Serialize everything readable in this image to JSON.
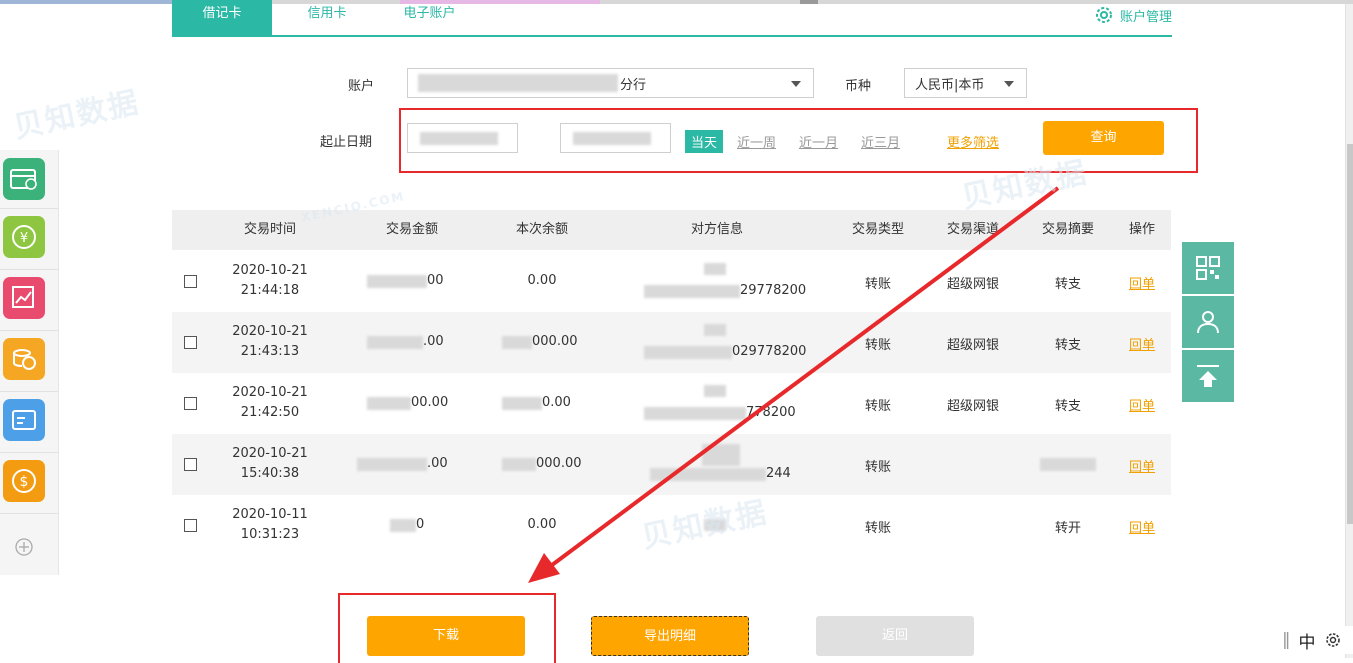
{
  "tabs": [
    {
      "label": "借记卡",
      "active": true
    },
    {
      "label": "信用卡",
      "active": false
    },
    {
      "label": "电子账户",
      "active": false
    }
  ],
  "account_manage": "账户管理",
  "filters": {
    "account_label": "账户",
    "account_suffix": "分行",
    "currency_label": "币种",
    "currency_value": "人民币|本币",
    "date_label": "起止日期",
    "today": "当天",
    "week": "近一周",
    "month": "近一月",
    "three_months": "近三月",
    "more_filters": "更多筛选",
    "query": "查询"
  },
  "table": {
    "headers": [
      "交易时间",
      "交易金额",
      "本次余额",
      "对方信息",
      "交易类型",
      "交易渠道",
      "交易摘要",
      "操作"
    ],
    "rows": [
      {
        "date": "2020-10-21",
        "time": "21:44:18",
        "amount": "00",
        "balance": "0.00",
        "party": "29778200",
        "type": "转账",
        "channel": "超级网银",
        "summary": "转支",
        "action": "回单"
      },
      {
        "date": "2020-10-21",
        "time": "21:43:13",
        "amount": ".00",
        "balance": "000.00",
        "party": "029778200",
        "type": "转账",
        "channel": "超级网银",
        "summary": "转支",
        "action": "回单"
      },
      {
        "date": "2020-10-21",
        "time": "21:42:50",
        "amount": "00.00",
        "balance": "0.00",
        "party": "778200",
        "type": "转账",
        "channel": "超级网银",
        "summary": "转支",
        "action": "回单"
      },
      {
        "date": "2020-10-21",
        "time": "15:40:38",
        "amount": ".00",
        "balance": "000.00",
        "party": "244",
        "type": "转账",
        "channel": "",
        "summary": "",
        "action": "回单"
      },
      {
        "date": "2020-10-11",
        "time": "10:31:23",
        "amount": "0",
        "balance": "0.00",
        "party": "",
        "type": "转账",
        "channel": "",
        "summary": "转开",
        "action": "回单"
      }
    ]
  },
  "buttons": {
    "download": "下载",
    "export": "导出明细",
    "back": "返回"
  },
  "ime": {
    "lang": "中"
  },
  "watermark": {
    "brand_cn": "贝知数据",
    "brand_en": "XENCIO.COM"
  },
  "colors": {
    "teal": "#2bb8a5",
    "orange": "#ffa500",
    "red_annotation": "#e8292b"
  }
}
